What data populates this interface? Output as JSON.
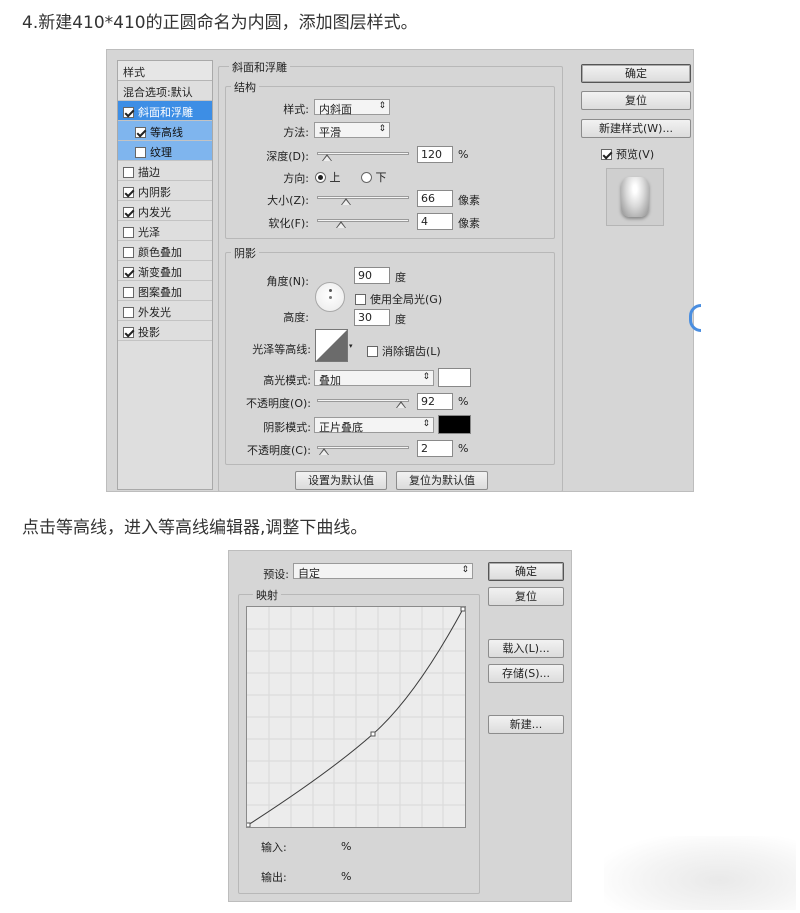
{
  "heading": "4.新建410*410的正圆命名为内圆，添加图层样式。",
  "layer_style": {
    "styles_header": "样式",
    "blend_options": "混合选项:默认",
    "items": [
      {
        "label": "斜面和浮雕",
        "checked": true,
        "state": "selected"
      },
      {
        "label": "等高线",
        "checked": true,
        "state": "sub"
      },
      {
        "label": "纹理",
        "checked": false,
        "state": "sub"
      },
      {
        "label": "描边",
        "checked": false,
        "state": "normal"
      },
      {
        "label": "内阴影",
        "checked": true,
        "state": "normal"
      },
      {
        "label": "内发光",
        "checked": true,
        "state": "normal"
      },
      {
        "label": "光泽",
        "checked": false,
        "state": "normal"
      },
      {
        "label": "颜色叠加",
        "checked": false,
        "state": "normal"
      },
      {
        "label": "渐变叠加",
        "checked": true,
        "state": "normal"
      },
      {
        "label": "图案叠加",
        "checked": false,
        "state": "normal"
      },
      {
        "label": "外发光",
        "checked": false,
        "state": "normal"
      },
      {
        "label": "投影",
        "checked": true,
        "state": "normal"
      }
    ],
    "section_title": "斜面和浮雕",
    "structure": {
      "title": "结构",
      "style_label": "样式:",
      "style_value": "内斜面",
      "technique_label": "方法:",
      "technique_value": "平滑",
      "depth_label": "深度(D):",
      "depth_value": "120",
      "depth_unit": "%",
      "direction_label": "方向:",
      "direction_up": "上",
      "direction_down": "下",
      "size_label": "大小(Z):",
      "size_value": "66",
      "size_unit": "像素",
      "soften_label": "软化(F):",
      "soften_value": "4",
      "soften_unit": "像素"
    },
    "shading": {
      "title": "阴影",
      "angle_label": "角度(N):",
      "angle_value": "90",
      "angle_unit": "度",
      "global_light_label": "使用全局光(G)",
      "altitude_label": "高度:",
      "altitude_value": "30",
      "altitude_unit": "度",
      "gloss_contour_label": "光泽等高线:",
      "antialias_label": "消除锯齿(L)",
      "highlight_mode_label": "高光模式:",
      "highlight_mode_value": "叠加",
      "highlight_color": "#ffffff",
      "highlight_opacity_label": "不透明度(O):",
      "highlight_opacity_value": "92",
      "highlight_opacity_unit": "%",
      "shadow_mode_label": "阴影模式:",
      "shadow_mode_value": "正片叠底",
      "shadow_color": "#000000",
      "shadow_opacity_label": "不透明度(C):",
      "shadow_opacity_value": "2",
      "shadow_opacity_unit": "%"
    },
    "make_default": "设置为默认值",
    "reset_default": "复位为默认值",
    "ok": "确定",
    "reset": "复位",
    "new_style": "新建样式(W)...",
    "preview_label": "预览(V)"
  },
  "instruction": "点击等高线，进入等高线编辑器,调整下曲线。",
  "contour_editor": {
    "preset_label": "预设:",
    "preset_value": "自定",
    "mapping_title": "映射",
    "input_label": "输入:",
    "input_unit": "%",
    "output_label": "输出:",
    "output_unit": "%",
    "ok": "确定",
    "reset": "复位",
    "load": "载入(L)...",
    "save": "存储(S)...",
    "new": "新建..."
  },
  "accent_color": "#3d8ee5"
}
